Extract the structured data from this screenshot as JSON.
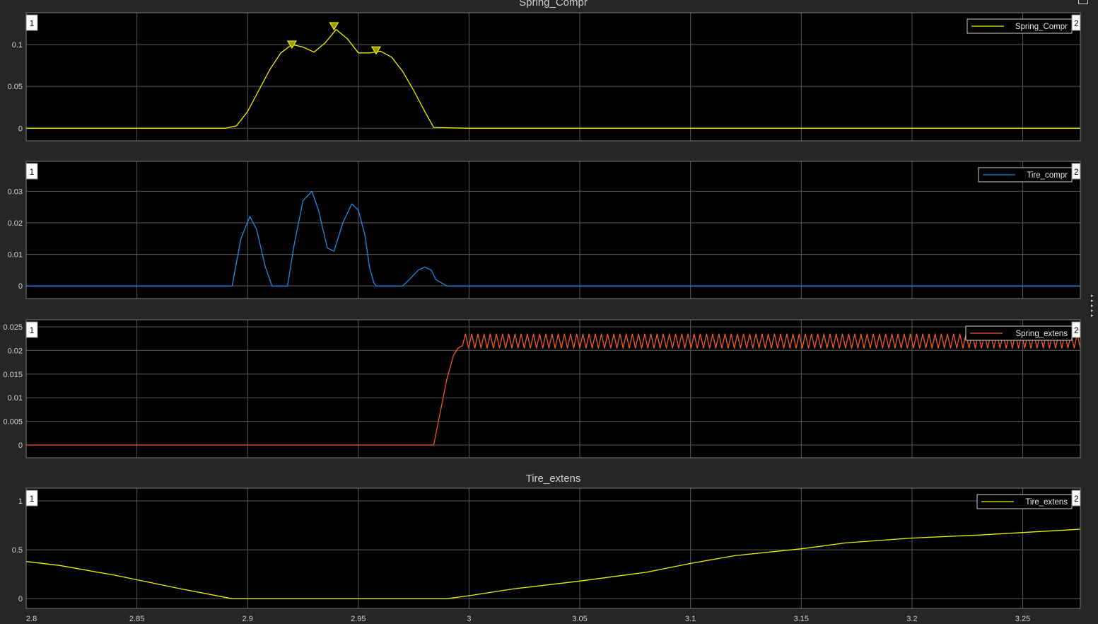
{
  "colors": {
    "background": "#262626",
    "axes": "#000000",
    "grid": "#5a5a5a",
    "tick_text": "#d0d0d0",
    "title_text": "#d0d0d0",
    "yellow": "#f0f000",
    "blue": "#1f8ce8",
    "orange": "#f05a28"
  },
  "icons": {
    "edge_arrows": "triangle-right-icon",
    "corner": "layout-icon"
  },
  "chart_data": [
    {
      "type": "line",
      "title": "Spring_Compr",
      "display_number_left": "1",
      "display_number_right": "2",
      "xlim": [
        2.8,
        3.276
      ],
      "ylim": [
        -0.015,
        0.138
      ],
      "yticks": [
        0,
        0.05,
        0.1
      ],
      "ytick_labels": [
        "0",
        "0.05",
        "0.1"
      ],
      "xticks": [
        2.8,
        2.85,
        2.9,
        2.95,
        3,
        3.05,
        3.1,
        3.15,
        3.2,
        3.25
      ],
      "grid": true,
      "legend": "top-right",
      "series": [
        {
          "name": "Spring_Compr",
          "color": "#f0f000",
          "x": [
            2.8,
            2.89,
            2.895,
            2.9,
            2.905,
            2.91,
            2.915,
            2.92,
            2.925,
            2.93,
            2.935,
            2.94,
            2.945,
            2.95,
            2.955,
            2.96,
            2.965,
            2.97,
            2.975,
            2.98,
            2.984,
            3.0,
            3.276
          ],
          "y": [
            0,
            0,
            0.003,
            0.02,
            0.045,
            0.07,
            0.09,
            0.1,
            0.097,
            0.091,
            0.102,
            0.118,
            0.107,
            0.09,
            0.09,
            0.092,
            0.085,
            0.068,
            0.045,
            0.02,
            0.001,
            0,
            0
          ]
        }
      ],
      "markers": [
        {
          "x": 2.92,
          "y": 0.1
        },
        {
          "x": 2.939,
          "y": 0.122
        },
        {
          "x": 2.958,
          "y": 0.093
        }
      ]
    },
    {
      "type": "line",
      "title": "",
      "display_number_left": "1",
      "display_number_right": "2",
      "xlim": [
        2.8,
        3.276
      ],
      "ylim": [
        -0.004,
        0.0395
      ],
      "yticks": [
        0,
        0.01,
        0.02,
        0.03
      ],
      "ytick_labels": [
        "0",
        "0.01",
        "0.02",
        "0.03"
      ],
      "xticks": [
        2.8,
        2.85,
        2.9,
        2.95,
        3,
        3.05,
        3.1,
        3.15,
        3.2,
        3.25
      ],
      "grid": true,
      "legend": "top-right",
      "series": [
        {
          "name": "Tire_compr",
          "color": "#1f8ce8",
          "x": [
            2.8,
            2.893,
            2.897,
            2.901,
            2.904,
            2.908,
            2.911,
            2.918,
            2.921,
            2.925,
            2.929,
            2.932,
            2.936,
            2.939,
            2.943,
            2.947,
            2.95,
            2.953,
            2.955,
            2.957,
            2.958,
            2.97,
            2.973,
            2.977,
            2.98,
            2.983,
            2.985,
            2.99,
            3.276
          ],
          "y": [
            0,
            0,
            0.015,
            0.022,
            0.018,
            0.006,
            0,
            0,
            0.013,
            0.027,
            0.03,
            0.024,
            0.012,
            0.011,
            0.02,
            0.026,
            0.024,
            0.016,
            0.006,
            0.001,
            0,
            0,
            0.002,
            0.005,
            0.006,
            0.005,
            0.002,
            0,
            0
          ]
        }
      ]
    },
    {
      "type": "line",
      "title": "",
      "display_number_left": "1",
      "display_number_right": "2",
      "xlim": [
        2.8,
        3.276
      ],
      "ylim": [
        -0.0027,
        0.0265
      ],
      "yticks": [
        0,
        0.005,
        0.01,
        0.015,
        0.02,
        0.025
      ],
      "ytick_labels": [
        "0",
        "0.005",
        "0.01",
        "0.015",
        "0.02",
        "0.025"
      ],
      "xticks": [
        2.8,
        2.85,
        2.9,
        2.95,
        3,
        3.05,
        3.1,
        3.15,
        3.2,
        3.25
      ],
      "grid": true,
      "legend": "top-right",
      "series": [
        {
          "name": "Spring_extens",
          "color": "#f05a28",
          "x": [
            2.8,
            2.984,
            2.987,
            2.99,
            2.993,
            2.995,
            2.997
          ],
          "y": [
            0,
            0,
            0.007,
            0.014,
            0.019,
            0.0205,
            0.021
          ]
        }
      ],
      "oscillation": {
        "x_start": 2.997,
        "x_end": 3.276,
        "y_low": 0.0205,
        "y_high": 0.0235,
        "cycles": 100
      }
    },
    {
      "type": "line",
      "title": "Tire_extens",
      "display_number_left": "1",
      "display_number_right": "2",
      "xlim": [
        2.8,
        3.276
      ],
      "ylim": [
        -0.1,
        1.13
      ],
      "yticks": [
        0,
        0.5,
        1
      ],
      "ytick_labels": [
        "0",
        "0.5",
        "1"
      ],
      "xticks": [
        2.8,
        2.85,
        2.9,
        2.95,
        3,
        3.05,
        3.1,
        3.15,
        3.2,
        3.25
      ],
      "xtick_labels": [
        "2.8",
        "2.85",
        "2.9",
        "2.95",
        "3",
        "3.05",
        "3.1",
        "3.15",
        "3.2",
        "3.25"
      ],
      "grid": true,
      "legend": "top-right",
      "series": [
        {
          "name": "Tire_extens",
          "color": "#f0f000",
          "x": [
            2.8,
            2.815,
            2.84,
            2.87,
            2.893,
            2.9,
            2.92,
            2.95,
            2.975,
            2.99,
            3.0,
            3.02,
            3.05,
            3.08,
            3.1,
            3.12,
            3.15,
            3.17,
            3.2,
            3.23,
            3.276
          ],
          "y": [
            0.38,
            0.34,
            0.24,
            0.1,
            0.0,
            0.0,
            0.0,
            0.0,
            0.0,
            0.0,
            0.03,
            0.1,
            0.18,
            0.27,
            0.36,
            0.44,
            0.51,
            0.57,
            0.62,
            0.65,
            0.71
          ]
        }
      ]
    }
  ]
}
